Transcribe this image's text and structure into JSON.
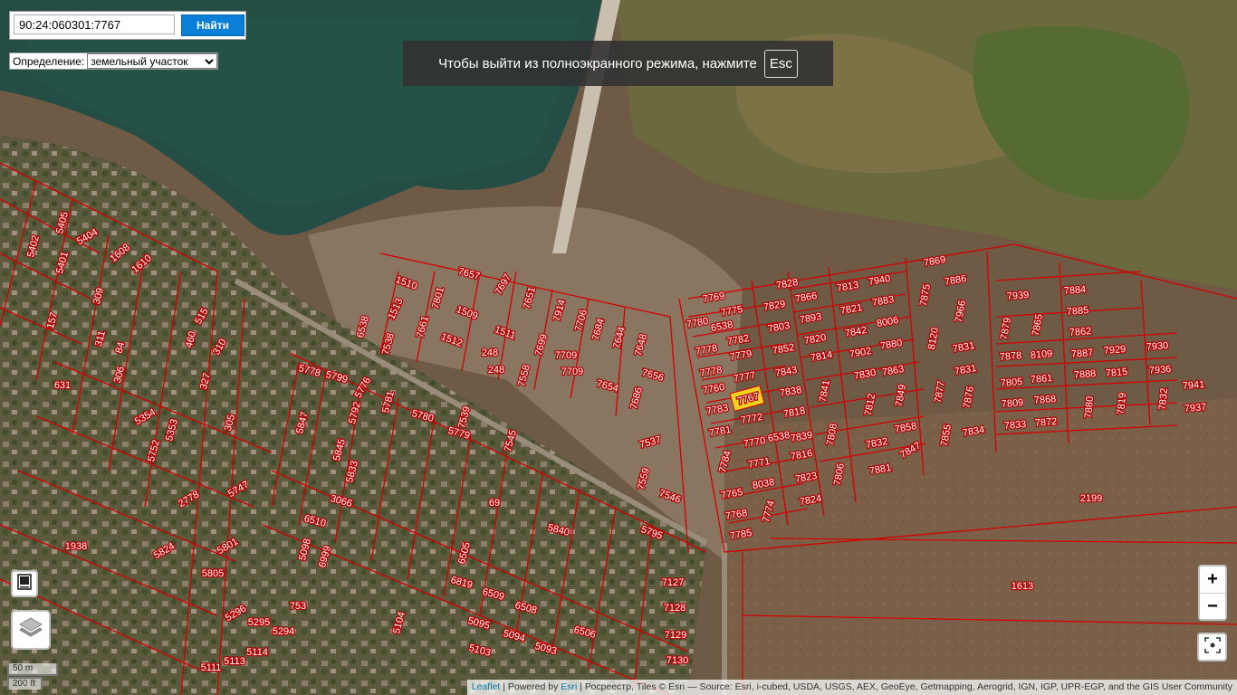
{
  "search": {
    "value": "90:24:060301:7767",
    "button_label": "Найти"
  },
  "definition": {
    "label": "Определение:",
    "selected": "земельный участок"
  },
  "fullscreen_notice": {
    "text": "Чтобы выйти из полноэкранного режима, нажмите",
    "key": "Esc"
  },
  "zoom": {
    "in_label": "+",
    "out_label": "−"
  },
  "scale": {
    "metric": "50 m",
    "imperial": "200 ft"
  },
  "attribution": {
    "leaflet": "Leaflet",
    "powered_by": "Powered by",
    "esri": "Esri",
    "rest": "| Росреестр, Tiles © Esri — Source: Esri, i-cubed, USDA, USGS, AEX, GeoEye, Getmapping, Aerogrid, IGN, IGP, UPR-EGP, and the GIS User Community"
  },
  "icons": {
    "print": "print-icon",
    "layers": "layers-icon",
    "locate": "locate-icon"
  },
  "colors": {
    "parcel_border": "#d40000",
    "selected_parcel": "#f0d020",
    "button": "#0a7fd8"
  },
  "selected_parcel": "7767",
  "parcels": [
    {
      "label": "7769"
    },
    {
      "label": "7775"
    },
    {
      "label": "7780"
    },
    {
      "label": "6538"
    },
    {
      "label": "7782"
    },
    {
      "label": "7778"
    },
    {
      "label": "7779"
    },
    {
      "label": "7778"
    },
    {
      "label": "7777"
    },
    {
      "label": "7760"
    },
    {
      "label": "7767"
    },
    {
      "label": "7783"
    },
    {
      "label": "7772"
    },
    {
      "label": "7781"
    },
    {
      "label": "7770"
    },
    {
      "label": "6538"
    },
    {
      "label": "7784"
    },
    {
      "label": "7771"
    },
    {
      "label": "7765"
    },
    {
      "label": "8038"
    },
    {
      "label": "7768"
    },
    {
      "label": "7774"
    },
    {
      "label": "7785"
    },
    {
      "label": "7828"
    },
    {
      "label": "7829"
    },
    {
      "label": "7866"
    },
    {
      "label": "7803"
    },
    {
      "label": "7893"
    },
    {
      "label": "7852"
    },
    {
      "label": "7820"
    },
    {
      "label": "7814"
    },
    {
      "label": "7843"
    },
    {
      "label": "7838"
    },
    {
      "label": "7841"
    },
    {
      "label": "7818"
    },
    {
      "label": "7839"
    },
    {
      "label": "7816"
    },
    {
      "label": "7808"
    },
    {
      "label": "7823"
    },
    {
      "label": "7824"
    },
    {
      "label": "7806"
    },
    {
      "label": "7813"
    },
    {
      "label": "7940"
    },
    {
      "label": "7821"
    },
    {
      "label": "7883"
    },
    {
      "label": "7842"
    },
    {
      "label": "8006"
    },
    {
      "label": "7902"
    },
    {
      "label": "7880"
    },
    {
      "label": "7830"
    },
    {
      "label": "7863"
    },
    {
      "label": "7812"
    },
    {
      "label": "7849"
    },
    {
      "label": "7832"
    },
    {
      "label": "7858"
    },
    {
      "label": "7847"
    },
    {
      "label": "7881"
    },
    {
      "label": "7869"
    },
    {
      "label": "7875"
    },
    {
      "label": "7886"
    },
    {
      "label": "7966"
    },
    {
      "label": "8120"
    },
    {
      "label": "7831"
    },
    {
      "label": "7831"
    },
    {
      "label": "7877"
    },
    {
      "label": "7876"
    },
    {
      "label": "7855"
    },
    {
      "label": "7834"
    },
    {
      "label": "7939"
    },
    {
      "label": "7879"
    },
    {
      "label": "7865"
    },
    {
      "label": "7878"
    },
    {
      "label": "8109"
    },
    {
      "label": "7805"
    },
    {
      "label": "7861"
    },
    {
      "label": "7809"
    },
    {
      "label": "7868"
    },
    {
      "label": "7833"
    },
    {
      "label": "7872"
    },
    {
      "label": "7884"
    },
    {
      "label": "7885"
    },
    {
      "label": "7862"
    },
    {
      "label": "7887"
    },
    {
      "label": "7929"
    },
    {
      "label": "7888"
    },
    {
      "label": "7815"
    },
    {
      "label": "7880"
    },
    {
      "label": "7819"
    },
    {
      "label": "7930"
    },
    {
      "label": "7936"
    },
    {
      "label": "7832"
    },
    {
      "label": "7941"
    },
    {
      "label": "7937"
    },
    {
      "label": "2199"
    },
    {
      "label": "1613"
    },
    {
      "label": "7657"
    },
    {
      "label": "7697"
    },
    {
      "label": "1510"
    },
    {
      "label": "7801"
    },
    {
      "label": "7651"
    },
    {
      "label": "1513"
    },
    {
      "label": "1509"
    },
    {
      "label": "7914"
    },
    {
      "label": "7706"
    },
    {
      "label": "6538"
    },
    {
      "label": "7538"
    },
    {
      "label": "7661"
    },
    {
      "label": "1511"
    },
    {
      "label": "7684"
    },
    {
      "label": "7644"
    },
    {
      "label": "7648"
    },
    {
      "label": "1512"
    },
    {
      "label": "248"
    },
    {
      "label": "7699"
    },
    {
      "label": "7709"
    },
    {
      "label": "7656"
    },
    {
      "label": "248"
    },
    {
      "label": "7709"
    },
    {
      "label": "7654"
    },
    {
      "label": "7686"
    },
    {
      "label": "7558"
    },
    {
      "label": "7545"
    },
    {
      "label": "7539"
    },
    {
      "label": "7537"
    },
    {
      "label": "7559"
    },
    {
      "label": "7546"
    },
    {
      "label": "5778"
    },
    {
      "label": "5799"
    },
    {
      "label": "5776"
    },
    {
      "label": "5781"
    },
    {
      "label": "5780"
    },
    {
      "label": "5779"
    },
    {
      "label": "5847"
    },
    {
      "label": "5792"
    },
    {
      "label": "5845"
    },
    {
      "label": "5833"
    },
    {
      "label": "3066"
    },
    {
      "label": "6510"
    },
    {
      "label": "5098"
    },
    {
      "label": "6999"
    },
    {
      "label": "5840"
    },
    {
      "label": "5795"
    },
    {
      "label": "69"
    },
    {
      "label": "6505"
    },
    {
      "label": "6819"
    },
    {
      "label": "6509"
    },
    {
      "label": "6508"
    },
    {
      "label": "6506"
    },
    {
      "label": "5095"
    },
    {
      "label": "5094"
    },
    {
      "label": "5093"
    },
    {
      "label": "5103"
    },
    {
      "label": "5104"
    },
    {
      "label": "7127"
    },
    {
      "label": "7128"
    },
    {
      "label": "7129"
    },
    {
      "label": "7130"
    },
    {
      "label": "5404"
    },
    {
      "label": "5405"
    },
    {
      "label": "5401"
    },
    {
      "label": "5402"
    },
    {
      "label": "1608"
    },
    {
      "label": "1610"
    },
    {
      "label": "157"
    },
    {
      "label": "631"
    },
    {
      "label": "515"
    },
    {
      "label": "310"
    },
    {
      "label": "460"
    },
    {
      "label": "327"
    },
    {
      "label": "305"
    },
    {
      "label": "84"
    },
    {
      "label": "311"
    },
    {
      "label": "306"
    },
    {
      "label": "309"
    },
    {
      "label": "5354"
    },
    {
      "label": "5353"
    },
    {
      "label": "5752"
    },
    {
      "label": "5747"
    },
    {
      "label": "2778"
    },
    {
      "label": "5801"
    },
    {
      "label": "5805"
    },
    {
      "label": "5824"
    },
    {
      "label": "1938"
    },
    {
      "label": "5296"
    },
    {
      "label": "5295"
    },
    {
      "label": "5294"
    },
    {
      "label": "753"
    },
    {
      "label": "5114"
    },
    {
      "label": "5113"
    },
    {
      "label": "5111"
    }
  ]
}
